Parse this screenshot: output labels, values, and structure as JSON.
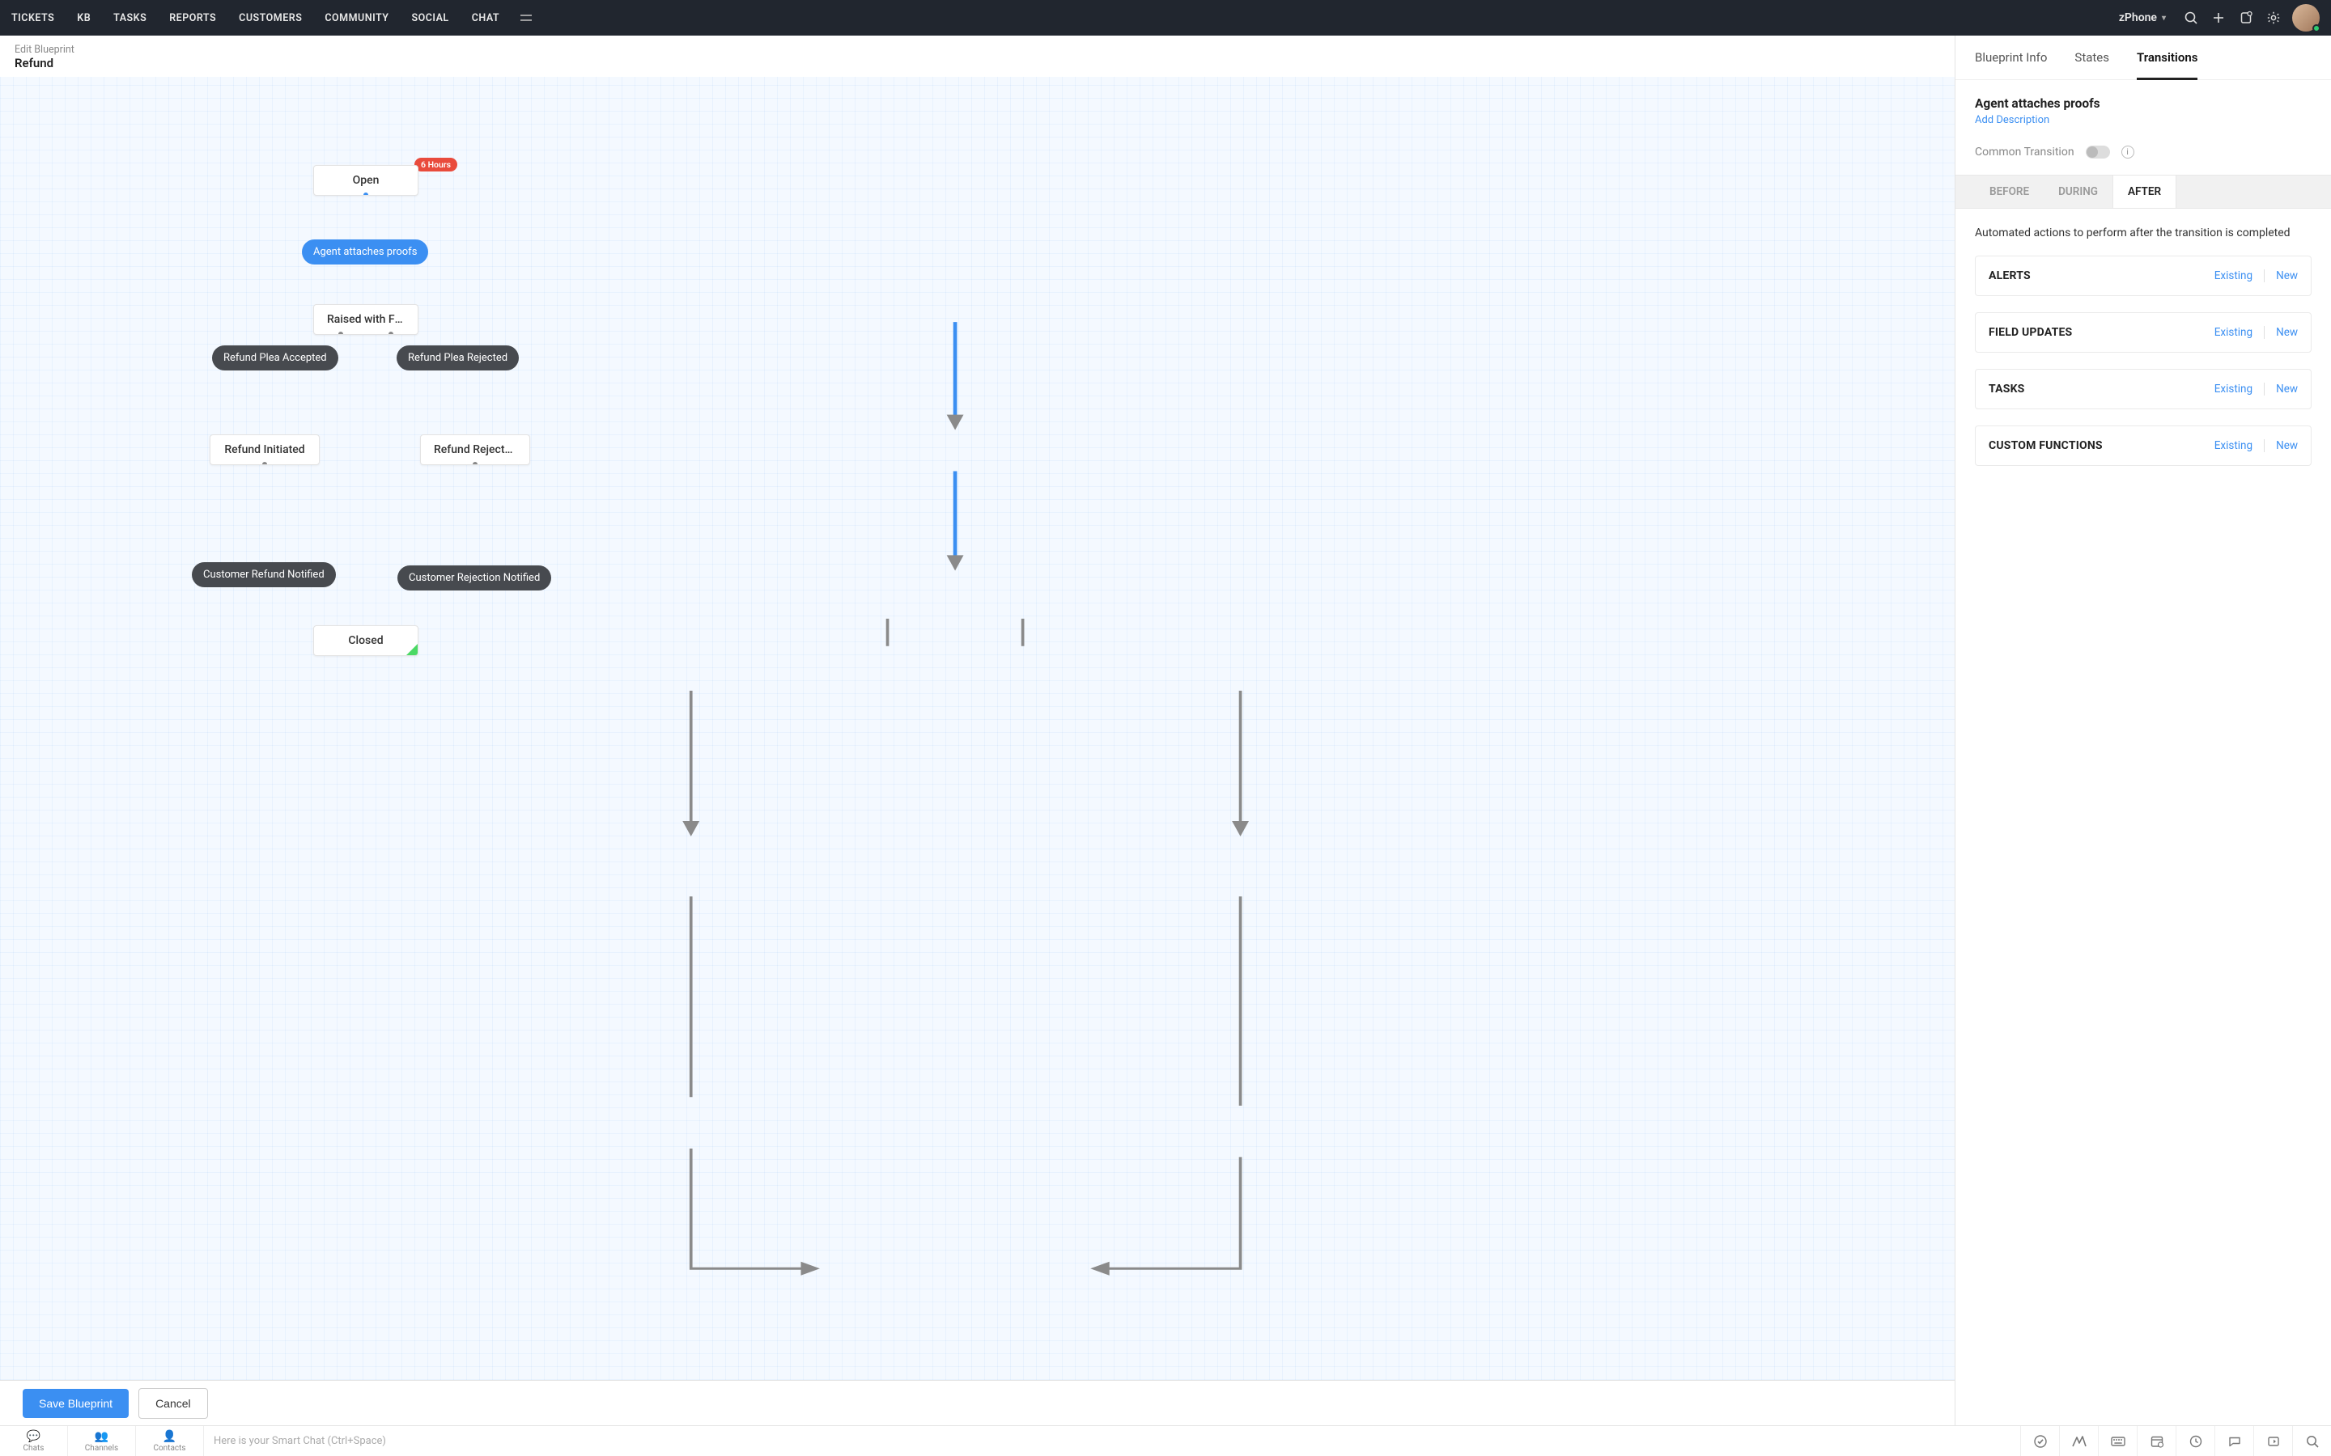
{
  "topnav": {
    "items": [
      "TICKETS",
      "KB",
      "TASKS",
      "REPORTS",
      "CUSTOMERS",
      "COMMUNITY",
      "SOCIAL",
      "CHAT"
    ],
    "brand": "zPhone"
  },
  "breadcrumb": {
    "crumb": "Edit Blueprint",
    "title": "Refund"
  },
  "canvas": {
    "sla_badge": "6 Hours",
    "states": {
      "open": "Open",
      "raised": "Raised with Fin...",
      "refund_initiated": "Refund Initiated",
      "refund_rejected": "Refund Rejected",
      "closed": "Closed"
    },
    "transitions": {
      "attach_proof": "Agent attaches proofs",
      "plea_accepted": "Refund Plea Accepted",
      "plea_rejected": "Refund Plea Rejected",
      "cust_refund_notified": "Customer Refund Notified",
      "cust_reject_notified": "Customer Rejection Notified"
    }
  },
  "footer": {
    "save": "Save Blueprint",
    "cancel": "Cancel"
  },
  "panel": {
    "tabs": [
      "Blueprint Info",
      "States",
      "Transitions"
    ],
    "active_tab": 2,
    "transition_name": "Agent attaches proofs",
    "add_desc": "Add Description",
    "common_transition": "Common Transition",
    "phase_tabs": [
      "BEFORE",
      "DURING",
      "AFTER"
    ],
    "active_phase": 2,
    "phase_desc": "Automated actions to perform after the transition is completed",
    "actions": [
      {
        "title": "ALERTS",
        "existing": "Existing",
        "new": "New"
      },
      {
        "title": "FIELD UPDATES",
        "existing": "Existing",
        "new": "New"
      },
      {
        "title": "TASKS",
        "existing": "Existing",
        "new": "New"
      },
      {
        "title": "CUSTOM FUNCTIONS",
        "existing": "Existing",
        "new": "New"
      }
    ]
  },
  "bottombar": {
    "tabs": [
      "Chats",
      "Channels",
      "Contacts"
    ],
    "chat_placeholder": "Here is your Smart Chat (Ctrl+Space)"
  }
}
